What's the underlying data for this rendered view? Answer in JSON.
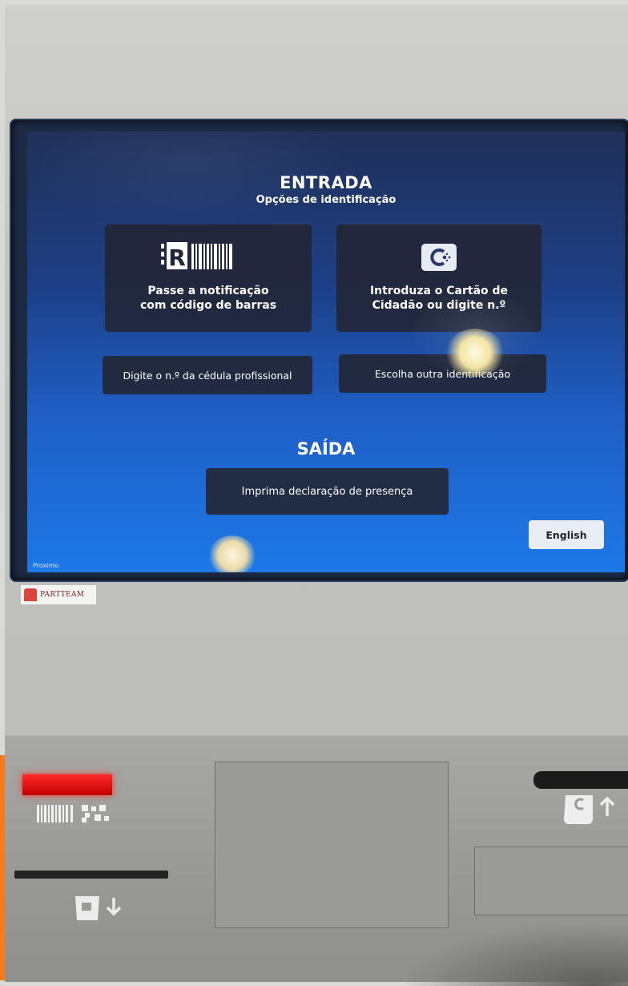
{
  "screen": {
    "title": "ENTRADA",
    "subtitle": "Opções de identificação",
    "options": {
      "barcode": {
        "line1": "Passe a notificação",
        "line2": "com código de barras"
      },
      "citizen_card": {
        "line1": "Introduza o Cartão de",
        "line2": "Cidadão ou digite n.º"
      }
    },
    "cedula_button": "Digite o n.º da cédula profissional",
    "other_id_button": "Escolha outra identificação",
    "exit_title": "SAÍDA",
    "print_button": "Imprima declaração de presença",
    "language_button": "English",
    "corner_brand": "Proximo"
  },
  "housing": {
    "logo_text": "PARTTEAM"
  },
  "colors": {
    "screen_accent": "#1d78e8",
    "tile_background": "#222634",
    "scanner_light": "#ff2a2a",
    "side_strip": "#f47b20"
  },
  "icons": [
    "barcode-r-icon",
    "citizen-card-icon",
    "barcode-qr-scanner-icon",
    "card-dispense-icon",
    "card-insert-icon"
  ]
}
